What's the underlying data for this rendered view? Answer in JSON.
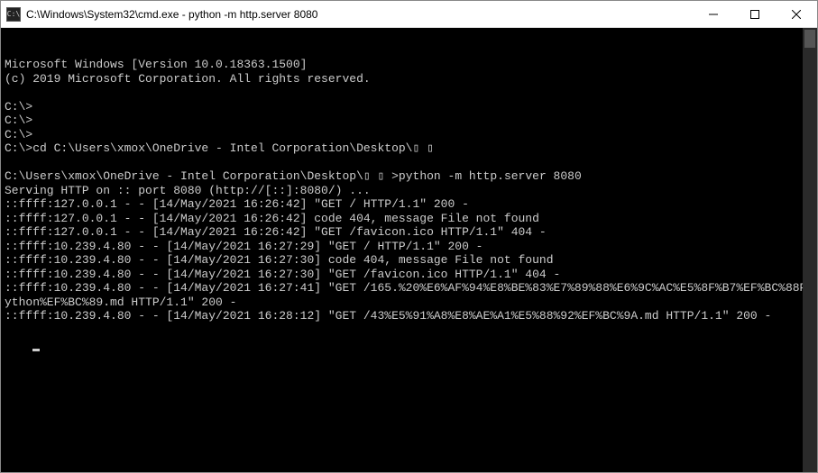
{
  "titlebar": {
    "icon_label": "C:\\",
    "title": "C:\\Windows\\System32\\cmd.exe - python  -m http.server 8080"
  },
  "terminal": {
    "lines": [
      "Microsoft Windows [Version 10.0.18363.1500]",
      "(c) 2019 Microsoft Corporation. All rights reserved.",
      "",
      "C:\\>",
      "C:\\>",
      "C:\\>",
      "C:\\>cd C:\\Users\\xmox\\OneDrive - Intel Corporation\\Desktop\\▯ ▯",
      "",
      "C:\\Users\\xmox\\OneDrive - Intel Corporation\\Desktop\\▯ ▯ >python -m http.server 8080",
      "Serving HTTP on :: port 8080 (http://[::]:8080/) ...",
      "::ffff:127.0.0.1 - - [14/May/2021 16:26:42] \"GET / HTTP/1.1\" 200 -",
      "::ffff:127.0.0.1 - - [14/May/2021 16:26:42] code 404, message File not found",
      "::ffff:127.0.0.1 - - [14/May/2021 16:26:42] \"GET /favicon.ico HTTP/1.1\" 404 -",
      "::ffff:10.239.4.80 - - [14/May/2021 16:27:29] \"GET / HTTP/1.1\" 200 -",
      "::ffff:10.239.4.80 - - [14/May/2021 16:27:30] code 404, message File not found",
      "::ffff:10.239.4.80 - - [14/May/2021 16:27:30] \"GET /favicon.ico HTTP/1.1\" 404 -",
      "::ffff:10.239.4.80 - - [14/May/2021 16:27:41] \"GET /165.%20%E6%AF%94%E8%BE%83%E7%89%88%E6%9C%AC%E5%8F%B7%EF%BC%88Python%EF%BC%89.md HTTP/1.1\" 200 -",
      "::ffff:10.239.4.80 - - [14/May/2021 16:28:12] \"GET /43%E5%91%A8%E8%AE%A1%E5%88%92%EF%BC%9A.md HTTP/1.1\" 200 -"
    ]
  }
}
